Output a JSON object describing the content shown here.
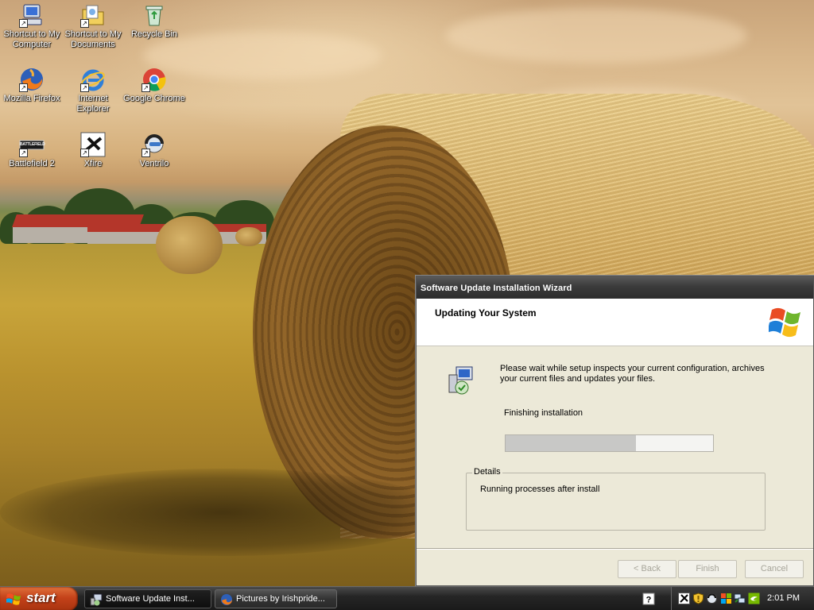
{
  "desktop": {
    "icons": [
      {
        "label": "Shortcut to My Computer",
        "icon": "my-computer-icon"
      },
      {
        "label": "Shortcut to My Documents",
        "icon": "my-documents-icon"
      },
      {
        "label": "Recycle Bin",
        "icon": "recycle-bin-icon"
      },
      {
        "label": "Mozilla Firefox",
        "icon": "firefox-icon"
      },
      {
        "label": "Internet Explorer",
        "icon": "internet-explorer-icon"
      },
      {
        "label": "Google Chrome",
        "icon": "chrome-icon"
      },
      {
        "label": "Battlefield 2",
        "icon": "battlefield-icon",
        "badge": "BATTLEFIELD"
      },
      {
        "label": "Xfire",
        "icon": "xfire-icon"
      },
      {
        "label": "Ventrilo",
        "icon": "ventrilo-icon"
      }
    ]
  },
  "wizard": {
    "title": "Software Update Installation Wizard",
    "header_title": "Updating Your System",
    "message": "Please wait while setup inspects your current configuration, archives your current files and updates your files.",
    "status": "Finishing installation",
    "progress_percent": 63,
    "details_label": "Details",
    "details_text": "Running processes after install",
    "buttons": {
      "back": "< Back",
      "finish": "Finish",
      "cancel": "Cancel"
    }
  },
  "taskbar": {
    "start_label": "start",
    "tasks": [
      {
        "label": "Software Update Inst...",
        "icon": "software-update-icon"
      },
      {
        "label": "Pictures by Irishpride...",
        "icon": "firefox-icon"
      }
    ],
    "clock": "2:01 PM",
    "colors": {
      "start": "#c4421a",
      "taskbar": "#262626"
    }
  }
}
